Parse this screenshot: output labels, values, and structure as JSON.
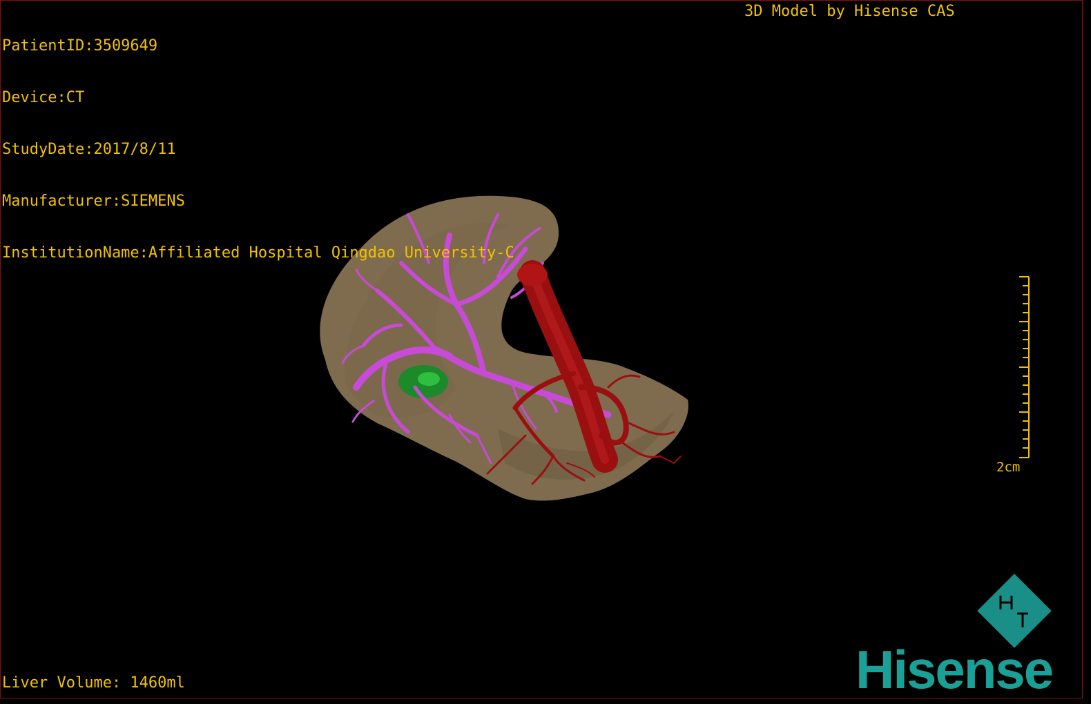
{
  "overlay": {
    "patient_id": "PatientID:3509649",
    "device": "Device:CT",
    "study_date": "StudyDate:2017/8/11",
    "manufacturer": "Manufacturer:SIEMENS",
    "institution": "InstitutionName:Affiliated Hospital Qingdao University-C",
    "credit": "3D Model by Hisense CAS",
    "liver_volume": "Liver Volume: 1460ml"
  },
  "scale_bar": {
    "label": "2cm"
  },
  "logo": {
    "word": "Hisense",
    "mark_icon": "hisense-ht-diamond-icon"
  },
  "colors": {
    "overlay_text": "#f2c200",
    "liver": "#8a7556",
    "portal_vein": "#c84ad8",
    "artery": "#9a1010",
    "lesion": "#1c8a2a",
    "brand": "#1aa197"
  }
}
